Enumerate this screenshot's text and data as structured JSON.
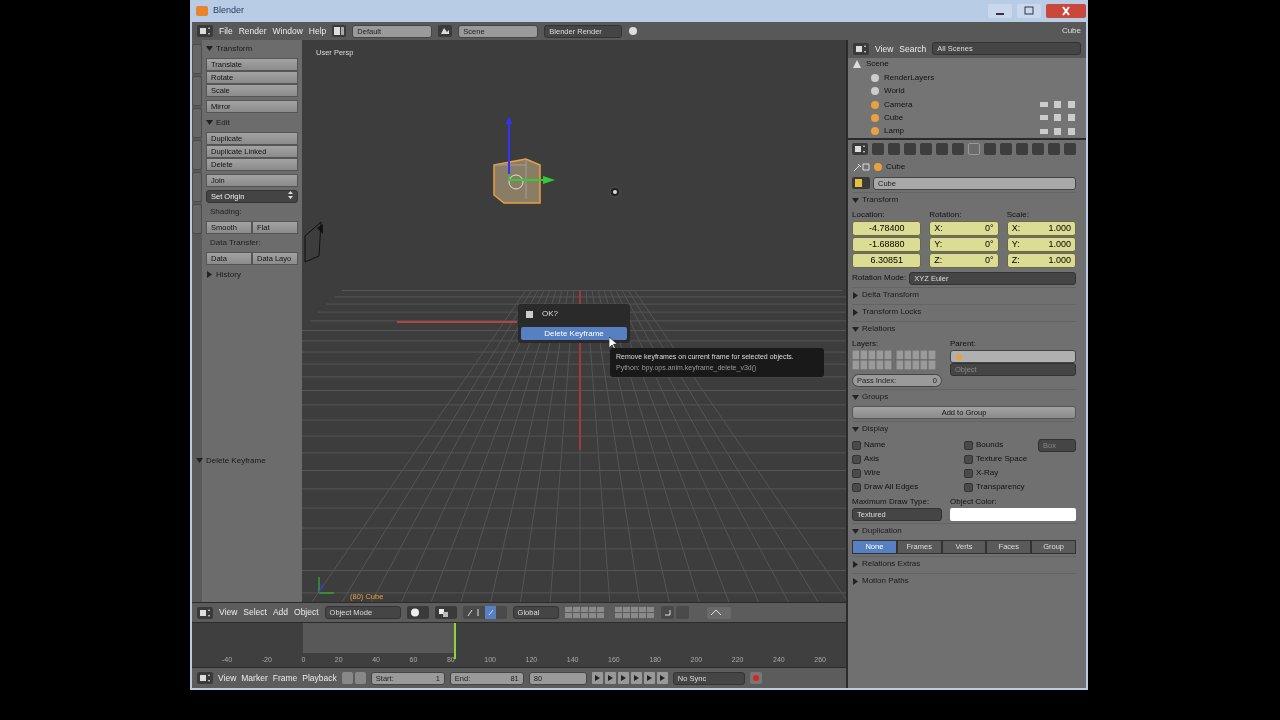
{
  "window": {
    "title": "Blender"
  },
  "info_header": {
    "menus": [
      "File",
      "Render",
      "Window",
      "Help"
    ],
    "layout": "Default",
    "scene": "Scene",
    "engine": "Blender Render",
    "stats": "Cube"
  },
  "tool_shelf": {
    "panels": [
      {
        "title": "Transform",
        "expanded": true,
        "rows": [
          {
            "kind": "stack",
            "items": [
              "Translate",
              "Rotate",
              "Scale"
            ]
          },
          {
            "kind": "stack",
            "items": [
              "Mirror"
            ]
          }
        ]
      },
      {
        "title": "Edit",
        "expanded": true,
        "rows": [
          {
            "kind": "stack",
            "items": [
              "Duplicate",
              "Duplicate Linked",
              "Delete"
            ]
          },
          {
            "kind": "stack",
            "items": [
              "Join"
            ]
          },
          {
            "kind": "dropdown",
            "text": "Set Origin"
          },
          {
            "kind": "label",
            "text": "Shading:"
          },
          {
            "kind": "pair",
            "items": [
              "Smooth",
              "Flat"
            ]
          },
          {
            "kind": "label",
            "text": "Data Transfer:"
          },
          {
            "kind": "pair",
            "items": [
              "Data",
              "Data Layo"
            ]
          }
        ]
      },
      {
        "title": "History",
        "expanded": false
      }
    ],
    "operator_panel": {
      "title": "Delete Keyframe",
      "expanded": true
    }
  },
  "viewport": {
    "view_name": "User Persp",
    "object_info": "(80) Cube",
    "popup": {
      "title": "OK?",
      "items": [
        {
          "label": "Delete Keyframe",
          "selected": true
        }
      ]
    },
    "tooltip": {
      "lines": [
        "Remove keyframes on current frame for selected objects.",
        "Python: bpy.ops.anim.keyframe_delete_v3d()"
      ]
    }
  },
  "outliner": {
    "menus": [
      "View",
      "Search"
    ],
    "filter": "All Scenes",
    "tree": [
      {
        "label": "Scene",
        "kind": "scene",
        "children": [
          {
            "label": "RenderLayers",
            "kind": "data"
          },
          {
            "label": "World",
            "kind": "data"
          },
          {
            "label": "Camera",
            "kind": "object"
          },
          {
            "label": "Cube",
            "kind": "object"
          },
          {
            "label": "Lamp",
            "kind": "object"
          }
        ]
      }
    ]
  },
  "properties": {
    "context_tabs": [
      {
        "selected": false
      },
      {
        "selected": false
      },
      {
        "selected": false
      },
      {
        "selected": false
      },
      {
        "selected": false
      },
      {
        "selected": false
      },
      {
        "selected": true
      },
      {
        "selected": false
      },
      {
        "selected": false
      },
      {
        "selected": false
      },
      {
        "selected": false
      },
      {
        "selected": false
      },
      {
        "selected": false
      }
    ],
    "breadcrumb": "Cube",
    "name": "Cube",
    "panels": [
      {
        "kind": "transform",
        "title": "Transform",
        "expanded": true,
        "columns": [
          {
            "label": "Location:",
            "keyed": true,
            "fields": [
              {
                "value": "-4.78400"
              },
              {
                "value": "-1.68880"
              },
              {
                "value": "6.30851"
              }
            ]
          },
          {
            "label": "Rotation:",
            "keyed": true,
            "fields": [
              {
                "axis": "X:",
                "value": "0°"
              },
              {
                "axis": "Y:",
                "value": "0°"
              },
              {
                "axis": "Z:",
                "value": "0°"
              }
            ]
          },
          {
            "label": "Scale:",
            "keyed": true,
            "fields": [
              {
                "axis": "X:",
                "value": "1.000"
              },
              {
                "axis": "Y:",
                "value": "1.000"
              },
              {
                "axis": "Z:",
                "value": "1.000"
              }
            ]
          }
        ],
        "rotation_mode": {
          "label": "Rotation Mode:",
          "value": "XYZ Euler"
        }
      },
      {
        "title": "Delta Transform",
        "expanded": false
      },
      {
        "title": "Transform Locks",
        "expanded": false
      },
      {
        "kind": "relations",
        "title": "Relations",
        "expanded": true,
        "layers_label": "Layers:",
        "parent_label": "Parent:",
        "parent_type": "Object",
        "pass_index": {
          "label": "Pass Index:",
          "value": "0"
        }
      },
      {
        "kind": "groups",
        "title": "Groups",
        "expanded": true,
        "button": "Add to Group"
      },
      {
        "kind": "display",
        "title": "Display",
        "expanded": true,
        "checks": [
          {
            "label": "Name",
            "checked": false
          },
          {
            "label": "Bounds",
            "checked": false
          },
          {
            "label": "Axis",
            "checked": false
          },
          {
            "label": "Texture Space",
            "checked": false
          },
          {
            "label": "Wire",
            "checked": false
          },
          {
            "label": "X-Ray",
            "checked": false
          },
          {
            "label": "Draw All Edges",
            "checked": false
          },
          {
            "label": "Transparency",
            "checked": false
          }
        ],
        "bounds_type": "Box",
        "draw_type": {
          "label": "Maximum Draw Type:",
          "value": "Textured"
        },
        "object_color": {
          "label": "Object Color:",
          "color": "#ffffff"
        }
      },
      {
        "kind": "duplication",
        "title": "Duplication",
        "expanded": true,
        "options": [
          {
            "label": "None",
            "selected": true
          },
          {
            "label": "Frames",
            "selected": false
          },
          {
            "label": "Verts",
            "selected": false
          },
          {
            "label": "Faces",
            "selected": false
          },
          {
            "label": "Group",
            "selected": false
          }
        ]
      },
      {
        "title": "Relations Extras",
        "expanded": false
      },
      {
        "title": "Motion Paths",
        "expanded": false
      }
    ]
  },
  "view_header": {
    "menus": [
      "View",
      "Select",
      "Add",
      "Object"
    ],
    "mode": "Object Mode",
    "orientation": "Global"
  },
  "timeline": {
    "ticks": [
      "-40",
      "-20",
      "0",
      "20",
      "40",
      "60",
      "80",
      "100",
      "120",
      "140",
      "160",
      "180",
      "200",
      "220",
      "240",
      "260"
    ],
    "level": 0.4
  },
  "timeline_header": {
    "menus": [
      "View",
      "Marker",
      "Frame",
      "Playback"
    ],
    "start": {
      "label": "Start:",
      "value": "1"
    },
    "end": {
      "label": "End:",
      "value": "81"
    },
    "current": "80",
    "sync": "No Sync"
  }
}
